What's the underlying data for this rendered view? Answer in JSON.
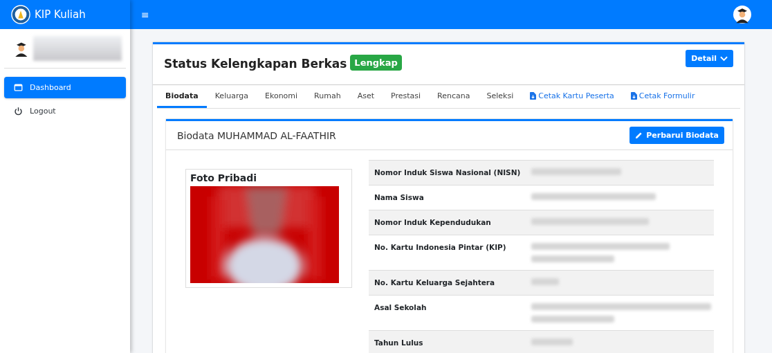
{
  "brand": {
    "title": "KIP Kuliah"
  },
  "topbar": {
    "menu_glyph": "≡"
  },
  "sidebar": {
    "items": [
      {
        "label": "Dashboard",
        "kind": "dashboard",
        "selected": true
      },
      {
        "label": "Logout",
        "kind": "logout",
        "selected": false
      }
    ]
  },
  "status": {
    "title": "Status Kelengkapan Berkas",
    "badge": "Lengkap",
    "detail_button": "Detail"
  },
  "tabs": [
    {
      "label": "Biodata",
      "kind": "tab",
      "selected": true
    },
    {
      "label": "Keluarga",
      "kind": "tab",
      "selected": false
    },
    {
      "label": "Ekonomi",
      "kind": "tab",
      "selected": false
    },
    {
      "label": "Rumah",
      "kind": "tab",
      "selected": false
    },
    {
      "label": "Aset",
      "kind": "tab",
      "selected": false
    },
    {
      "label": "Prestasi",
      "kind": "tab",
      "selected": false
    },
    {
      "label": "Rencana",
      "kind": "tab",
      "selected": false
    },
    {
      "label": "Seleksi",
      "kind": "tab",
      "selected": false
    },
    {
      "label": "Cetak Kartu Peserta",
      "kind": "print",
      "selected": false
    },
    {
      "label": "Cetak Formulir",
      "kind": "print",
      "selected": false
    }
  ],
  "biodata": {
    "title": "Biodata MUHAMMAD AL-FAATHIR",
    "update_button": "Perbarui Biodata",
    "photo_title": "Foto Pribadi",
    "rows": [
      {
        "label": "Nomor Induk Siswa Nasional (NISN)"
      },
      {
        "label": "Nama Siswa"
      },
      {
        "label": "Nomor Induk Kependudukan"
      },
      {
        "label": "No. Kartu Indonesia Pintar (KIP)"
      },
      {
        "label": "No. Kartu Keluarga Sejahtera"
      },
      {
        "label": "Asal Sekolah"
      },
      {
        "label": "Tahun Lulus"
      }
    ]
  }
}
